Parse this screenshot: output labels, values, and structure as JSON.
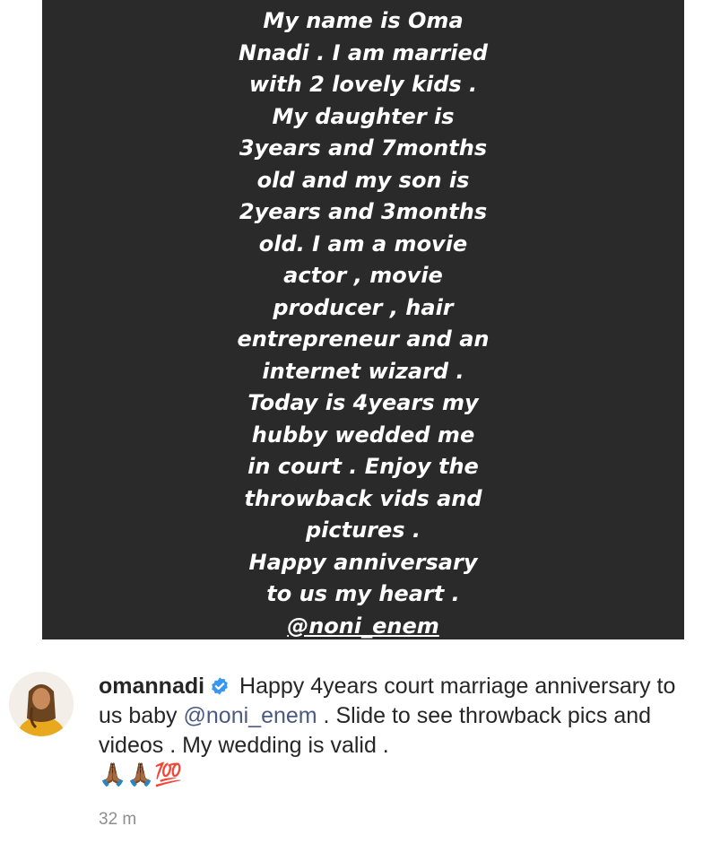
{
  "story": {
    "lines": [
      "My name is Oma",
      "Nnadi . I am married",
      "with 2 lovely kids .",
      "My daughter is",
      "3years and 7months",
      "old and my son is",
      "2years and 3months",
      "old.  I am a movie",
      "actor , movie",
      "producer , hair",
      "entrepreneur and an",
      "internet wizard .",
      "Today is 4years my",
      "hubby wedded me",
      "in court . Enjoy the",
      "throwback vids and",
      "pictures .",
      "Happy anniversary",
      "to us my heart ."
    ],
    "mention": "@noni_enem"
  },
  "comment": {
    "username": "omannadi",
    "text_before": "Happy 4years court marriage anniversary to us baby ",
    "mention": "@noni_enem",
    "text_after": " . Slide to see throwback pics and videos . My wedding is valid .",
    "emojis": "🙏🏾🙏🏾💯",
    "time": "32 m"
  },
  "colors": {
    "story_bg": "#2a2a2a",
    "verified": "#3897f0",
    "link": "#4a5a80"
  }
}
